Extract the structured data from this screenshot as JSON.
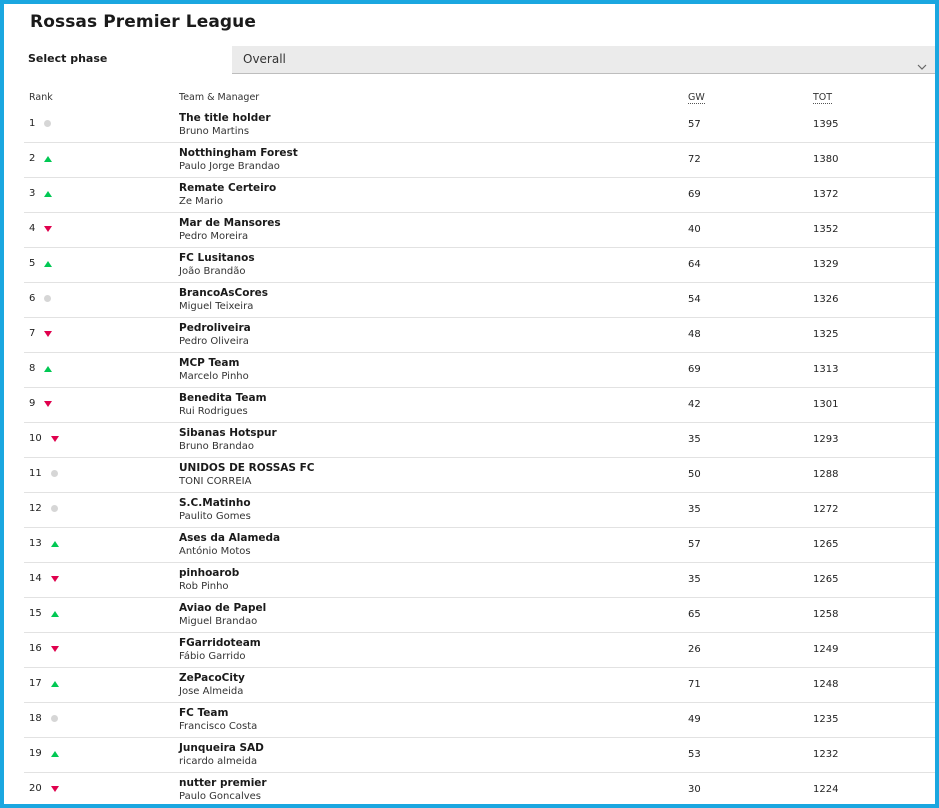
{
  "title": "Rossas Premier League",
  "phase": {
    "label": "Select phase",
    "selected": "Overall"
  },
  "columns": {
    "rank": "Rank",
    "team": "Team & Manager",
    "gw": "GW",
    "tot": "TOT"
  },
  "colors": {
    "up": "#00c853",
    "down": "#e0004d",
    "same": "#d6d6d6",
    "border": "#1aa7e0"
  },
  "rows": [
    {
      "rank": "1",
      "movement": "same",
      "team": "The title holder",
      "manager": "Bruno Martins",
      "gw": "57",
      "tot": "1395"
    },
    {
      "rank": "2",
      "movement": "up",
      "team": "Notthingham Forest",
      "manager": "Paulo Jorge Brandao",
      "gw": "72",
      "tot": "1380"
    },
    {
      "rank": "3",
      "movement": "up",
      "team": "Remate Certeiro",
      "manager": "Ze Mario",
      "gw": "69",
      "tot": "1372"
    },
    {
      "rank": "4",
      "movement": "down",
      "team": "Mar de Mansores",
      "manager": "Pedro Moreira",
      "gw": "40",
      "tot": "1352"
    },
    {
      "rank": "5",
      "movement": "up",
      "team": "FC Lusitanos",
      "manager": "João Brandão",
      "gw": "64",
      "tot": "1329"
    },
    {
      "rank": "6",
      "movement": "same",
      "team": "BrancoAsCores",
      "manager": "Miguel Teixeira",
      "gw": "54",
      "tot": "1326"
    },
    {
      "rank": "7",
      "movement": "down",
      "team": "Pedroliveira",
      "manager": "Pedro Oliveira",
      "gw": "48",
      "tot": "1325"
    },
    {
      "rank": "8",
      "movement": "up",
      "team": "MCP Team",
      "manager": "Marcelo Pinho",
      "gw": "69",
      "tot": "1313"
    },
    {
      "rank": "9",
      "movement": "down",
      "team": "Benedita Team",
      "manager": "Rui Rodrigues",
      "gw": "42",
      "tot": "1301"
    },
    {
      "rank": "10",
      "movement": "down",
      "team": "Sibanas Hotspur",
      "manager": "Bruno Brandao",
      "gw": "35",
      "tot": "1293"
    },
    {
      "rank": "11",
      "movement": "same",
      "team": "UNIDOS DE ROSSAS FC",
      "manager": "TONI CORREIA",
      "gw": "50",
      "tot": "1288"
    },
    {
      "rank": "12",
      "movement": "same",
      "team": "S.C.Matinho",
      "manager": "Paulito Gomes",
      "gw": "35",
      "tot": "1272"
    },
    {
      "rank": "13",
      "movement": "up",
      "team": "Ases da Alameda",
      "manager": "António Motos",
      "gw": "57",
      "tot": "1265"
    },
    {
      "rank": "14",
      "movement": "down",
      "team": "pinhoarob",
      "manager": "Rob Pinho",
      "gw": "35",
      "tot": "1265"
    },
    {
      "rank": "15",
      "movement": "up",
      "team": "Aviao de Papel",
      "manager": "Miguel Brandao",
      "gw": "65",
      "tot": "1258"
    },
    {
      "rank": "16",
      "movement": "down",
      "team": "FGarridoteam",
      "manager": "Fábio Garrido",
      "gw": "26",
      "tot": "1249"
    },
    {
      "rank": "17",
      "movement": "up",
      "team": "ZePacoCity",
      "manager": "Jose Almeida",
      "gw": "71",
      "tot": "1248"
    },
    {
      "rank": "18",
      "movement": "same",
      "team": "FC Team",
      "manager": "Francisco Costa",
      "gw": "49",
      "tot": "1235"
    },
    {
      "rank": "19",
      "movement": "up",
      "team": "Junqueira SAD",
      "manager": "ricardo almeida",
      "gw": "53",
      "tot": "1232"
    },
    {
      "rank": "20",
      "movement": "down",
      "team": "nutter premier",
      "manager": "Paulo Goncalves",
      "gw": "30",
      "tot": "1224"
    }
  ]
}
